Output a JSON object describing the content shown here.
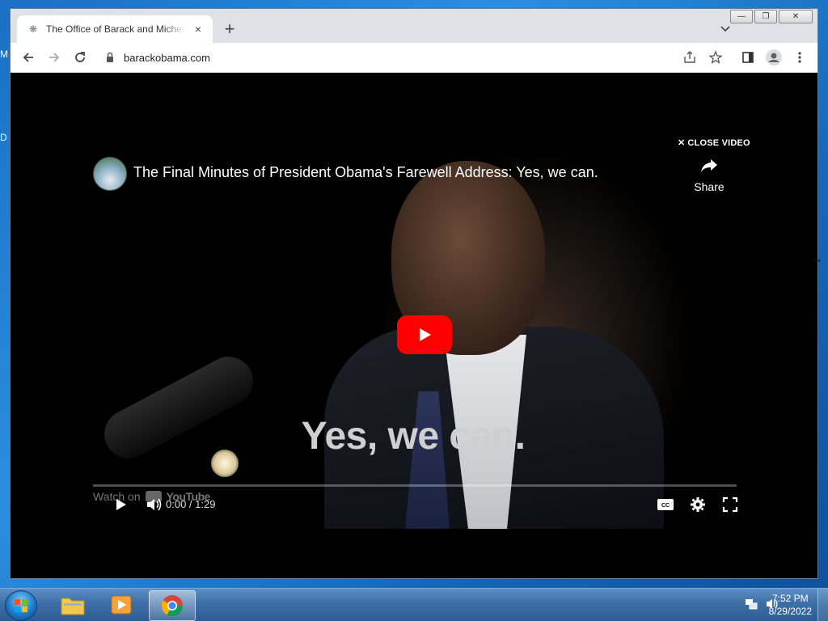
{
  "desktop": {
    "left_fragments": [
      "M",
      "D"
    ]
  },
  "window": {
    "controls": [
      "minimize",
      "restore",
      "close"
    ]
  },
  "tab": {
    "title": "The Office of Barack and Michelle Obama",
    "favicon": "seal-icon",
    "close": "×"
  },
  "tabstrip": {
    "new_tab": "+"
  },
  "toolbar": {
    "url": "barackobama.com"
  },
  "page": {
    "close_video": "CLOSE VIDEO",
    "video": {
      "title": "The Final Minutes of President Obama's Farewell Address: Yes, we can.",
      "share_label": "Share",
      "caption": "Yes, we can.",
      "watch_on": "Watch on",
      "youtube_word": "YouTube",
      "time": "0:00 / 1:29",
      "progress": 0.0
    }
  },
  "taskbar": {
    "clock_time": "7:52 PM",
    "clock_date": "8/29/2022",
    "apps": [
      "windows-explorer",
      "media-player",
      "chrome"
    ]
  }
}
